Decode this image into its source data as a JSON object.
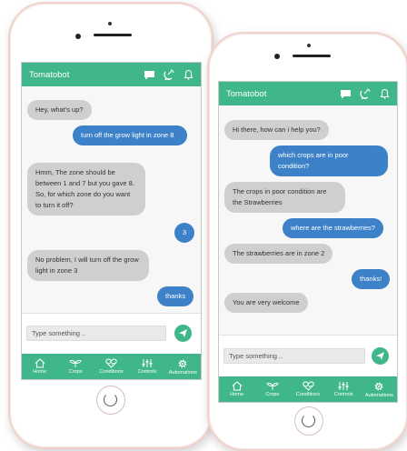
{
  "phones": [
    {
      "app_title": "Tomatobot",
      "messages": [
        {
          "from": "bot",
          "text": "Hey, what's up?"
        },
        {
          "from": "user",
          "text": "turn off the grow light in zone 8"
        },
        {
          "from": "bot",
          "text": "Hmm, The zone should be between 1 and 7 but you gave 8. So, for which zone do you want to turn it off?"
        },
        {
          "from": "user",
          "text": "3"
        },
        {
          "from": "bot",
          "text": "No problem, I will turn off the grow light in zone 3"
        },
        {
          "from": "user",
          "text": "thanks"
        }
      ],
      "input_placeholder": "Type something ..",
      "nav": [
        "Home",
        "Crops",
        "Conditions",
        "Controls",
        "Automations"
      ]
    },
    {
      "app_title": "Tomatobot",
      "messages": [
        {
          "from": "bot",
          "text": "Hi there, how can i help you?"
        },
        {
          "from": "user",
          "text": "which crops are in poor condition?"
        },
        {
          "from": "bot",
          "text": "The crops in poor condition are the Strawberries"
        },
        {
          "from": "user",
          "text": "where are the strawberries?"
        },
        {
          "from": "bot",
          "text": "The strawberries are in zone 2"
        },
        {
          "from": "user",
          "text": "thanks!"
        },
        {
          "from": "bot",
          "text": "You are very welcome"
        }
      ],
      "input_placeholder": "Type something ..",
      "nav": [
        "Home",
        "Crops",
        "Conditions",
        "Controls",
        "Automations"
      ]
    }
  ],
  "colors": {
    "accent": "#3fb78a",
    "user_bubble": "#3d82c8",
    "bot_bubble": "#cfcfcf"
  },
  "icons": {
    "appbar": [
      "chat-icon",
      "satellite-dish-icon",
      "bell-icon"
    ],
    "nav": [
      "home-icon",
      "sprout-icon",
      "heart-pulse-icon",
      "sliders-icon",
      "gear-icon"
    ],
    "send": "send-icon"
  }
}
